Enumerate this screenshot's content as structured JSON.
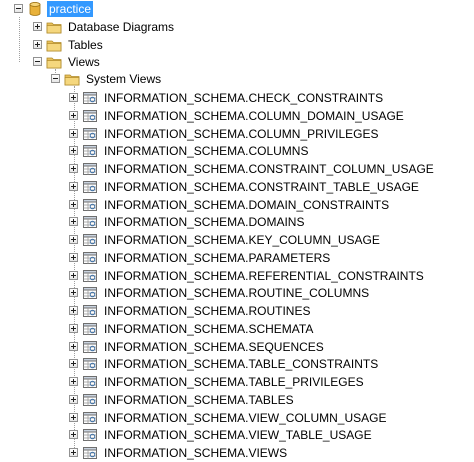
{
  "tree": {
    "root": {
      "label": "practice",
      "selected": true,
      "icon": "database-icon"
    },
    "nodes": [
      {
        "label": "Database Diagrams",
        "icon": "folder-icon",
        "expander": "plus"
      },
      {
        "label": "Tables",
        "icon": "folder-icon",
        "expander": "plus"
      },
      {
        "label": "Views",
        "icon": "folder-icon",
        "expander": "minus"
      }
    ],
    "system_views": {
      "label": "System Views",
      "icon": "folder-icon",
      "expander": "minus",
      "items": [
        "INFORMATION_SCHEMA.CHECK_CONSTRAINTS",
        "INFORMATION_SCHEMA.COLUMN_DOMAIN_USAGE",
        "INFORMATION_SCHEMA.COLUMN_PRIVILEGES",
        "INFORMATION_SCHEMA.COLUMNS",
        "INFORMATION_SCHEMA.CONSTRAINT_COLUMN_USAGE",
        "INFORMATION_SCHEMA.CONSTRAINT_TABLE_USAGE",
        "INFORMATION_SCHEMA.DOMAIN_CONSTRAINTS",
        "INFORMATION_SCHEMA.DOMAINS",
        "INFORMATION_SCHEMA.KEY_COLUMN_USAGE",
        "INFORMATION_SCHEMA.PARAMETERS",
        "INFORMATION_SCHEMA.REFERENTIAL_CONSTRAINTS",
        "INFORMATION_SCHEMA.ROUTINE_COLUMNS",
        "INFORMATION_SCHEMA.ROUTINES",
        "INFORMATION_SCHEMA.SCHEMATA",
        "INFORMATION_SCHEMA.SEQUENCES",
        "INFORMATION_SCHEMA.TABLE_CONSTRAINTS",
        "INFORMATION_SCHEMA.TABLE_PRIVILEGES",
        "INFORMATION_SCHEMA.TABLES",
        "INFORMATION_SCHEMA.VIEW_COLUMN_USAGE",
        "INFORMATION_SCHEMA.VIEW_TABLE_USAGE",
        "INFORMATION_SCHEMA.VIEWS"
      ]
    }
  }
}
